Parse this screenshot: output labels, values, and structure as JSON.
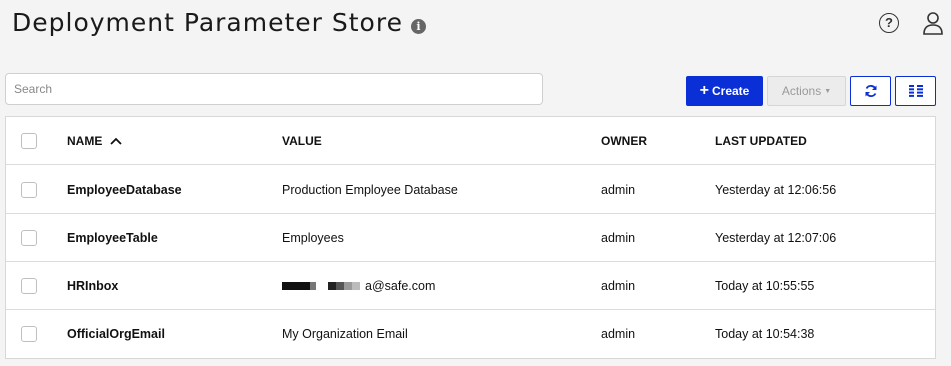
{
  "header": {
    "title": "Deployment Parameter Store",
    "info_icon": "info-icon",
    "help_icon": "help-icon",
    "user_icon": "user-icon"
  },
  "search": {
    "placeholder": "Search",
    "value": ""
  },
  "toolbar": {
    "create_label": "Create",
    "actions_label": "Actions",
    "refresh_icon": "refresh-icon",
    "columns_icon": "columns-icon"
  },
  "table": {
    "columns": [
      "NAME",
      "VALUE",
      "OWNER",
      "LAST UPDATED"
    ],
    "sort_column": "NAME",
    "sort_direction": "ascending",
    "rows": [
      {
        "name": "EmployeeDatabase",
        "value": "Production Employee Database",
        "owner": "admin",
        "updated": "Yesterday at 12:06:56"
      },
      {
        "name": "EmployeeTable",
        "value": "Employees",
        "owner": "admin",
        "updated": "Yesterday at 12:07:06"
      },
      {
        "name": "HRInbox",
        "value": "a@safe.com",
        "value_redacted": true,
        "owner": "admin",
        "updated": "Today at 10:55:55"
      },
      {
        "name": "OfficialOrgEmail",
        "value": "My Organization Email",
        "owner": "admin",
        "updated": "Today at 10:54:38"
      }
    ]
  },
  "colors": {
    "accent": "#0a2fd6",
    "background": "#f4f4f4"
  }
}
